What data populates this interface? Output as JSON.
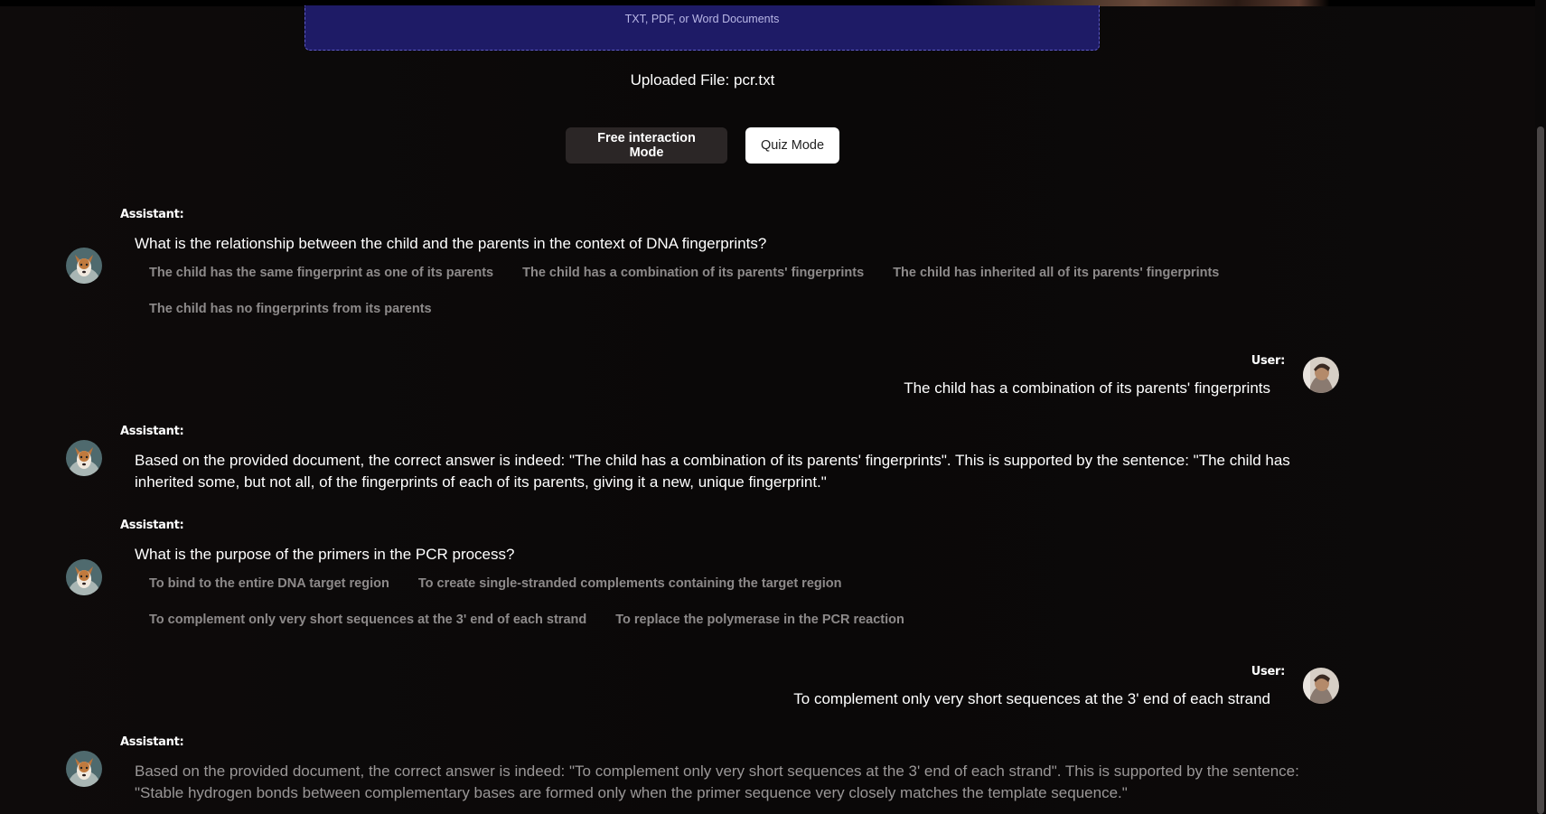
{
  "upload": {
    "hint": "TXT, PDF, or Word Documents",
    "uploaded_file": "Uploaded File: pcr.txt"
  },
  "modes": {
    "free_label": "Free interaction Mode",
    "quiz_label": "Quiz Mode"
  },
  "chat": {
    "assistant_label": "Assistant:",
    "user_label": "User:",
    "q1": {
      "question": "What is the relationship between the child and the parents in the context of DNA fingerprints?",
      "options": [
        "The child has the same fingerprint as one of its parents",
        "The child has a combination of its parents' fingerprints",
        "The child has inherited all of its parents' fingerprints",
        "The child has no fingerprints from its parents"
      ]
    },
    "a1_user": "The child has a combination of its parents' fingerprints",
    "r1": "Based on the provided document, the correct answer is indeed: \"The child has a combination of its parents' fingerprints\". This is supported by the sentence: \"The child has inherited some, but not all, of the fingerprints of each of its parents, giving it a new, unique fingerprint.\"",
    "q2": {
      "question": "What is the purpose of the primers in the PCR process?",
      "options": [
        "To bind to the entire DNA target region",
        "To create single-stranded complements containing the target region",
        "To complement only very short sequences at the 3' end of each strand",
        "To replace the polymerase in the PCR reaction"
      ]
    },
    "a2_user": "To complement only very short sequences at the 3' end of each strand",
    "r2": "Based on the provided document, the correct answer is indeed: \"To complement only very short sequences at the 3' end of each strand\". This is supported by the sentence: \"Stable hydrogen bonds between complementary bases are formed only when the primer sequence very closely matches the template sequence.\""
  },
  "icons": {
    "assistant_avatar": "dog-avatar-icon",
    "user_avatar": "user-photo-avatar-icon"
  }
}
